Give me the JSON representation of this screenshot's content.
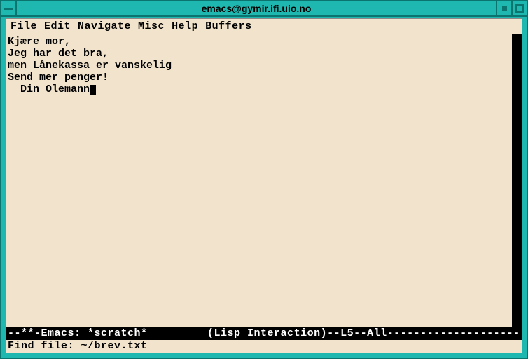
{
  "window": {
    "title": "emacs@gymir.ifi.uio.no"
  },
  "menubar": {
    "items": [
      "File",
      "Edit",
      "Navigate",
      "Misc",
      "Help",
      "Buffers"
    ]
  },
  "buffer": {
    "line1": "Kjære mor,",
    "line2": "Jeg har det bra,",
    "line3": "men Lånekassa er vanskelig",
    "line4": "Send mer penger!",
    "line5": "  Din Olemann"
  },
  "modeline": {
    "text": "--**-Emacs: *scratch*         (Lisp Interaction)--L5--All----------------------"
  },
  "minibuffer": {
    "text": "Find file: ~/brev.txt"
  }
}
